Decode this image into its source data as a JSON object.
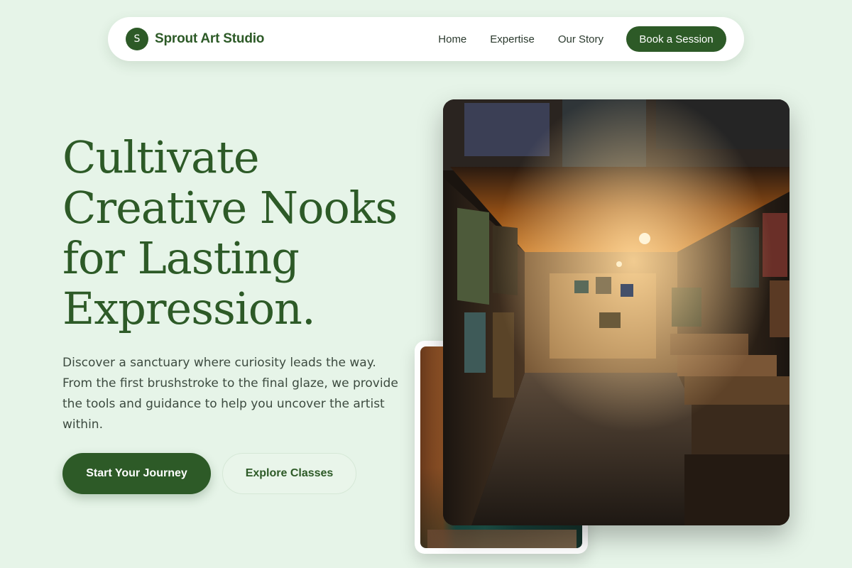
{
  "nav": {
    "logo_letter": "S",
    "brand_name": "Sprout Art Studio",
    "links": [
      "Home",
      "Expertise",
      "Our Story"
    ],
    "cta": "Book a Session"
  },
  "hero": {
    "title": "Cultivate\nCreative Nooks\nfor Lasting\nExpression.",
    "description": "Discover a sanctuary where curiosity leads the way. From the first brushstroke to the final glaze, we provide the tools and guidance to help you uncover the artist within.",
    "primary_button": "Start Your Journey",
    "secondary_button": "Explore Classes"
  },
  "colors": {
    "brand": "#2d5a27",
    "background": "#e6f4e8"
  }
}
